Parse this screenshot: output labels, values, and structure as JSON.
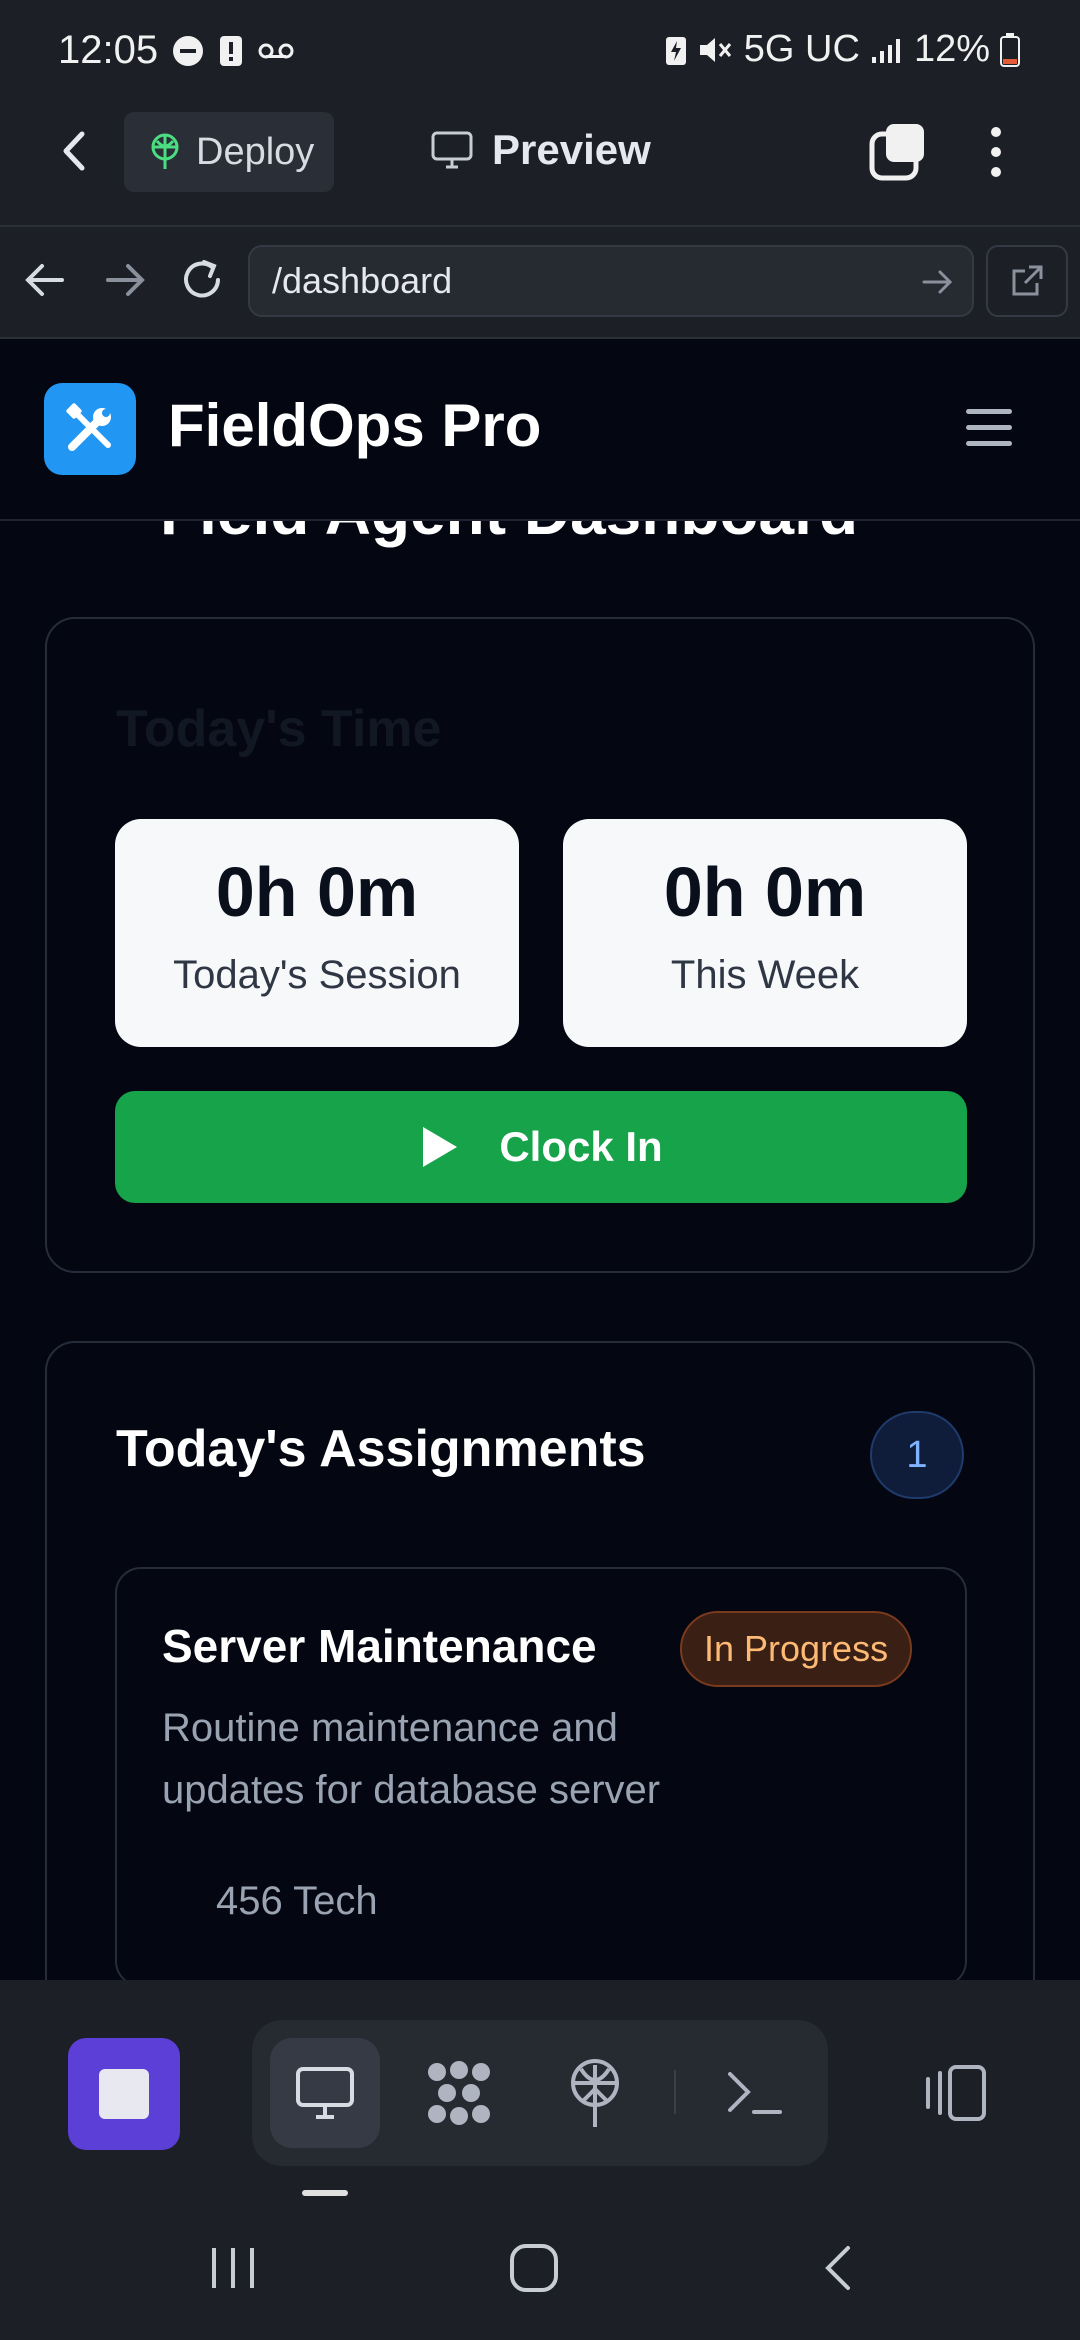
{
  "status_bar": {
    "time": "12:05",
    "network": "5G UC",
    "battery": "12%"
  },
  "app_bar": {
    "deploy_label": "Deploy",
    "preview_label": "Preview"
  },
  "url_bar": {
    "url": "/dashboard"
  },
  "site": {
    "brand": "FieldOps Pro",
    "page_title_partial": "Field Agent Dashboard"
  },
  "time_card": {
    "title": "Today's Time",
    "session_value": "0h 0m",
    "session_label": "Today's Session",
    "week_value": "0h 0m",
    "week_label": "This Week",
    "clock_in_label": "Clock In"
  },
  "assignments": {
    "title": "Today's Assignments",
    "count": "1",
    "items": [
      {
        "title": "Server Maintenance",
        "status": "In Progress",
        "description": "Routine maintenance and updates for database server",
        "address": "456 Tech"
      }
    ]
  },
  "colors": {
    "accent_blue": "#2196f3",
    "clock_in_green": "#16a34a",
    "status_orange": "#fdba74",
    "stop_purple": "#5b3fd6"
  },
  "icons": [
    "back-icon",
    "deploy-icon",
    "preview-monitor-icon",
    "tabs-icon",
    "more-icon",
    "nav-back-icon",
    "nav-forward-icon",
    "reload-icon",
    "go-icon",
    "external-link-icon",
    "wrench-screwdriver-icon",
    "hamburger-icon",
    "play-icon",
    "lightning-icon",
    "stop-icon",
    "desktop-icon",
    "agents-icon",
    "deploy-tool-icon",
    "terminal-icon",
    "split-view-icon"
  ]
}
